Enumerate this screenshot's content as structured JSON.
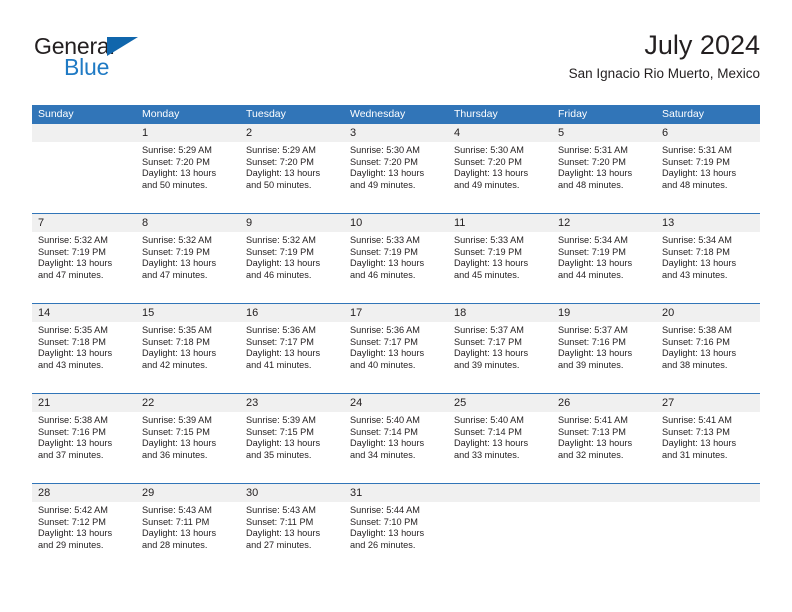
{
  "brand": {
    "word_one": "General",
    "word_two": "Blue",
    "triangle_icon": "triangle-icon",
    "colors": {
      "general_text": "#231f20",
      "blue_text": "#1f7ac4",
      "triangle": "#1066ac"
    }
  },
  "header": {
    "title": "July 2024",
    "subtitle": "San Ignacio Rio Muerto, Mexico"
  },
  "theme": {
    "header_blue": "#3175b8",
    "daynum_band": "#f0f0f0",
    "text": "#231f20",
    "week_separator": "#3175b8"
  },
  "weekdays": [
    "Sunday",
    "Monday",
    "Tuesday",
    "Wednesday",
    "Thursday",
    "Friday",
    "Saturday"
  ],
  "weeks": [
    {
      "days": [
        {
          "num": "",
          "sunrise": "",
          "sunset": "",
          "daylight_line1": "",
          "daylight_line2": ""
        },
        {
          "num": "1",
          "sunrise": "Sunrise: 5:29 AM",
          "sunset": "Sunset: 7:20 PM",
          "daylight_line1": "Daylight: 13 hours",
          "daylight_line2": "and 50 minutes."
        },
        {
          "num": "2",
          "sunrise": "Sunrise: 5:29 AM",
          "sunset": "Sunset: 7:20 PM",
          "daylight_line1": "Daylight: 13 hours",
          "daylight_line2": "and 50 minutes."
        },
        {
          "num": "3",
          "sunrise": "Sunrise: 5:30 AM",
          "sunset": "Sunset: 7:20 PM",
          "daylight_line1": "Daylight: 13 hours",
          "daylight_line2": "and 49 minutes."
        },
        {
          "num": "4",
          "sunrise": "Sunrise: 5:30 AM",
          "sunset": "Sunset: 7:20 PM",
          "daylight_line1": "Daylight: 13 hours",
          "daylight_line2": "and 49 minutes."
        },
        {
          "num": "5",
          "sunrise": "Sunrise: 5:31 AM",
          "sunset": "Sunset: 7:20 PM",
          "daylight_line1": "Daylight: 13 hours",
          "daylight_line2": "and 48 minutes."
        },
        {
          "num": "6",
          "sunrise": "Sunrise: 5:31 AM",
          "sunset": "Sunset: 7:19 PM",
          "daylight_line1": "Daylight: 13 hours",
          "daylight_line2": "and 48 minutes."
        }
      ]
    },
    {
      "days": [
        {
          "num": "7",
          "sunrise": "Sunrise: 5:32 AM",
          "sunset": "Sunset: 7:19 PM",
          "daylight_line1": "Daylight: 13 hours",
          "daylight_line2": "and 47 minutes."
        },
        {
          "num": "8",
          "sunrise": "Sunrise: 5:32 AM",
          "sunset": "Sunset: 7:19 PM",
          "daylight_line1": "Daylight: 13 hours",
          "daylight_line2": "and 47 minutes."
        },
        {
          "num": "9",
          "sunrise": "Sunrise: 5:32 AM",
          "sunset": "Sunset: 7:19 PM",
          "daylight_line1": "Daylight: 13 hours",
          "daylight_line2": "and 46 minutes."
        },
        {
          "num": "10",
          "sunrise": "Sunrise: 5:33 AM",
          "sunset": "Sunset: 7:19 PM",
          "daylight_line1": "Daylight: 13 hours",
          "daylight_line2": "and 46 minutes."
        },
        {
          "num": "11",
          "sunrise": "Sunrise: 5:33 AM",
          "sunset": "Sunset: 7:19 PM",
          "daylight_line1": "Daylight: 13 hours",
          "daylight_line2": "and 45 minutes."
        },
        {
          "num": "12",
          "sunrise": "Sunrise: 5:34 AM",
          "sunset": "Sunset: 7:19 PM",
          "daylight_line1": "Daylight: 13 hours",
          "daylight_line2": "and 44 minutes."
        },
        {
          "num": "13",
          "sunrise": "Sunrise: 5:34 AM",
          "sunset": "Sunset: 7:18 PM",
          "daylight_line1": "Daylight: 13 hours",
          "daylight_line2": "and 43 minutes."
        }
      ]
    },
    {
      "days": [
        {
          "num": "14",
          "sunrise": "Sunrise: 5:35 AM",
          "sunset": "Sunset: 7:18 PM",
          "daylight_line1": "Daylight: 13 hours",
          "daylight_line2": "and 43 minutes."
        },
        {
          "num": "15",
          "sunrise": "Sunrise: 5:35 AM",
          "sunset": "Sunset: 7:18 PM",
          "daylight_line1": "Daylight: 13 hours",
          "daylight_line2": "and 42 minutes."
        },
        {
          "num": "16",
          "sunrise": "Sunrise: 5:36 AM",
          "sunset": "Sunset: 7:17 PM",
          "daylight_line1": "Daylight: 13 hours",
          "daylight_line2": "and 41 minutes."
        },
        {
          "num": "17",
          "sunrise": "Sunrise: 5:36 AM",
          "sunset": "Sunset: 7:17 PM",
          "daylight_line1": "Daylight: 13 hours",
          "daylight_line2": "and 40 minutes."
        },
        {
          "num": "18",
          "sunrise": "Sunrise: 5:37 AM",
          "sunset": "Sunset: 7:17 PM",
          "daylight_line1": "Daylight: 13 hours",
          "daylight_line2": "and 39 minutes."
        },
        {
          "num": "19",
          "sunrise": "Sunrise: 5:37 AM",
          "sunset": "Sunset: 7:16 PM",
          "daylight_line1": "Daylight: 13 hours",
          "daylight_line2": "and 39 minutes."
        },
        {
          "num": "20",
          "sunrise": "Sunrise: 5:38 AM",
          "sunset": "Sunset: 7:16 PM",
          "daylight_line1": "Daylight: 13 hours",
          "daylight_line2": "and 38 minutes."
        }
      ]
    },
    {
      "days": [
        {
          "num": "21",
          "sunrise": "Sunrise: 5:38 AM",
          "sunset": "Sunset: 7:16 PM",
          "daylight_line1": "Daylight: 13 hours",
          "daylight_line2": "and 37 minutes."
        },
        {
          "num": "22",
          "sunrise": "Sunrise: 5:39 AM",
          "sunset": "Sunset: 7:15 PM",
          "daylight_line1": "Daylight: 13 hours",
          "daylight_line2": "and 36 minutes."
        },
        {
          "num": "23",
          "sunrise": "Sunrise: 5:39 AM",
          "sunset": "Sunset: 7:15 PM",
          "daylight_line1": "Daylight: 13 hours",
          "daylight_line2": "and 35 minutes."
        },
        {
          "num": "24",
          "sunrise": "Sunrise: 5:40 AM",
          "sunset": "Sunset: 7:14 PM",
          "daylight_line1": "Daylight: 13 hours",
          "daylight_line2": "and 34 minutes."
        },
        {
          "num": "25",
          "sunrise": "Sunrise: 5:40 AM",
          "sunset": "Sunset: 7:14 PM",
          "daylight_line1": "Daylight: 13 hours",
          "daylight_line2": "and 33 minutes."
        },
        {
          "num": "26",
          "sunrise": "Sunrise: 5:41 AM",
          "sunset": "Sunset: 7:13 PM",
          "daylight_line1": "Daylight: 13 hours",
          "daylight_line2": "and 32 minutes."
        },
        {
          "num": "27",
          "sunrise": "Sunrise: 5:41 AM",
          "sunset": "Sunset: 7:13 PM",
          "daylight_line1": "Daylight: 13 hours",
          "daylight_line2": "and 31 minutes."
        }
      ]
    },
    {
      "days": [
        {
          "num": "28",
          "sunrise": "Sunrise: 5:42 AM",
          "sunset": "Sunset: 7:12 PM",
          "daylight_line1": "Daylight: 13 hours",
          "daylight_line2": "and 29 minutes."
        },
        {
          "num": "29",
          "sunrise": "Sunrise: 5:43 AM",
          "sunset": "Sunset: 7:11 PM",
          "daylight_line1": "Daylight: 13 hours",
          "daylight_line2": "and 28 minutes."
        },
        {
          "num": "30",
          "sunrise": "Sunrise: 5:43 AM",
          "sunset": "Sunset: 7:11 PM",
          "daylight_line1": "Daylight: 13 hours",
          "daylight_line2": "and 27 minutes."
        },
        {
          "num": "31",
          "sunrise": "Sunrise: 5:44 AM",
          "sunset": "Sunset: 7:10 PM",
          "daylight_line1": "Daylight: 13 hours",
          "daylight_line2": "and 26 minutes."
        },
        {
          "num": "",
          "sunrise": "",
          "sunset": "",
          "daylight_line1": "",
          "daylight_line2": ""
        },
        {
          "num": "",
          "sunrise": "",
          "sunset": "",
          "daylight_line1": "",
          "daylight_line2": ""
        },
        {
          "num": "",
          "sunrise": "",
          "sunset": "",
          "daylight_line1": "",
          "daylight_line2": ""
        }
      ]
    }
  ]
}
